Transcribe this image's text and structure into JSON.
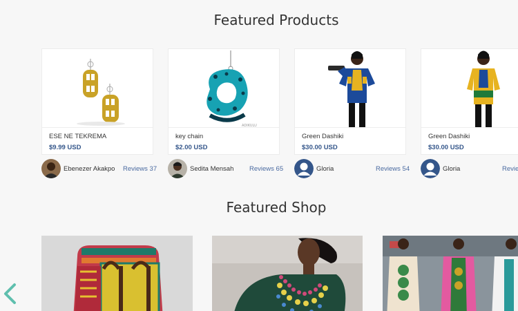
{
  "featured_products": {
    "title": "Featured Products",
    "products": [
      {
        "name": "ESE NE TEKREMA",
        "price": "$9.99 USD"
      },
      {
        "name": "key chain",
        "price": "$2.00 USD"
      },
      {
        "name": "Green Dashiki",
        "price": "$30.00 USD"
      },
      {
        "name": "Green Dashiki",
        "price": "$30.00 USD"
      }
    ],
    "sellers": [
      {
        "name": "Ebenezer Akakpo",
        "reviews": "Reviews 37"
      },
      {
        "name": "Sedita Mensah",
        "reviews": "Reviews 65"
      },
      {
        "name": "Gloria",
        "reviews": "Reviews 54"
      },
      {
        "name": "Gloria",
        "reviews": "Reviews"
      }
    ]
  },
  "featured_shop": {
    "title": "Featured Shop"
  },
  "nav": {
    "prev_icon": "chevron-left-icon",
    "accent": "#5fbfae"
  },
  "colors": {
    "price": "#34568a",
    "reviews": "#4a6aa0",
    "avatar_default": "#34568a"
  }
}
